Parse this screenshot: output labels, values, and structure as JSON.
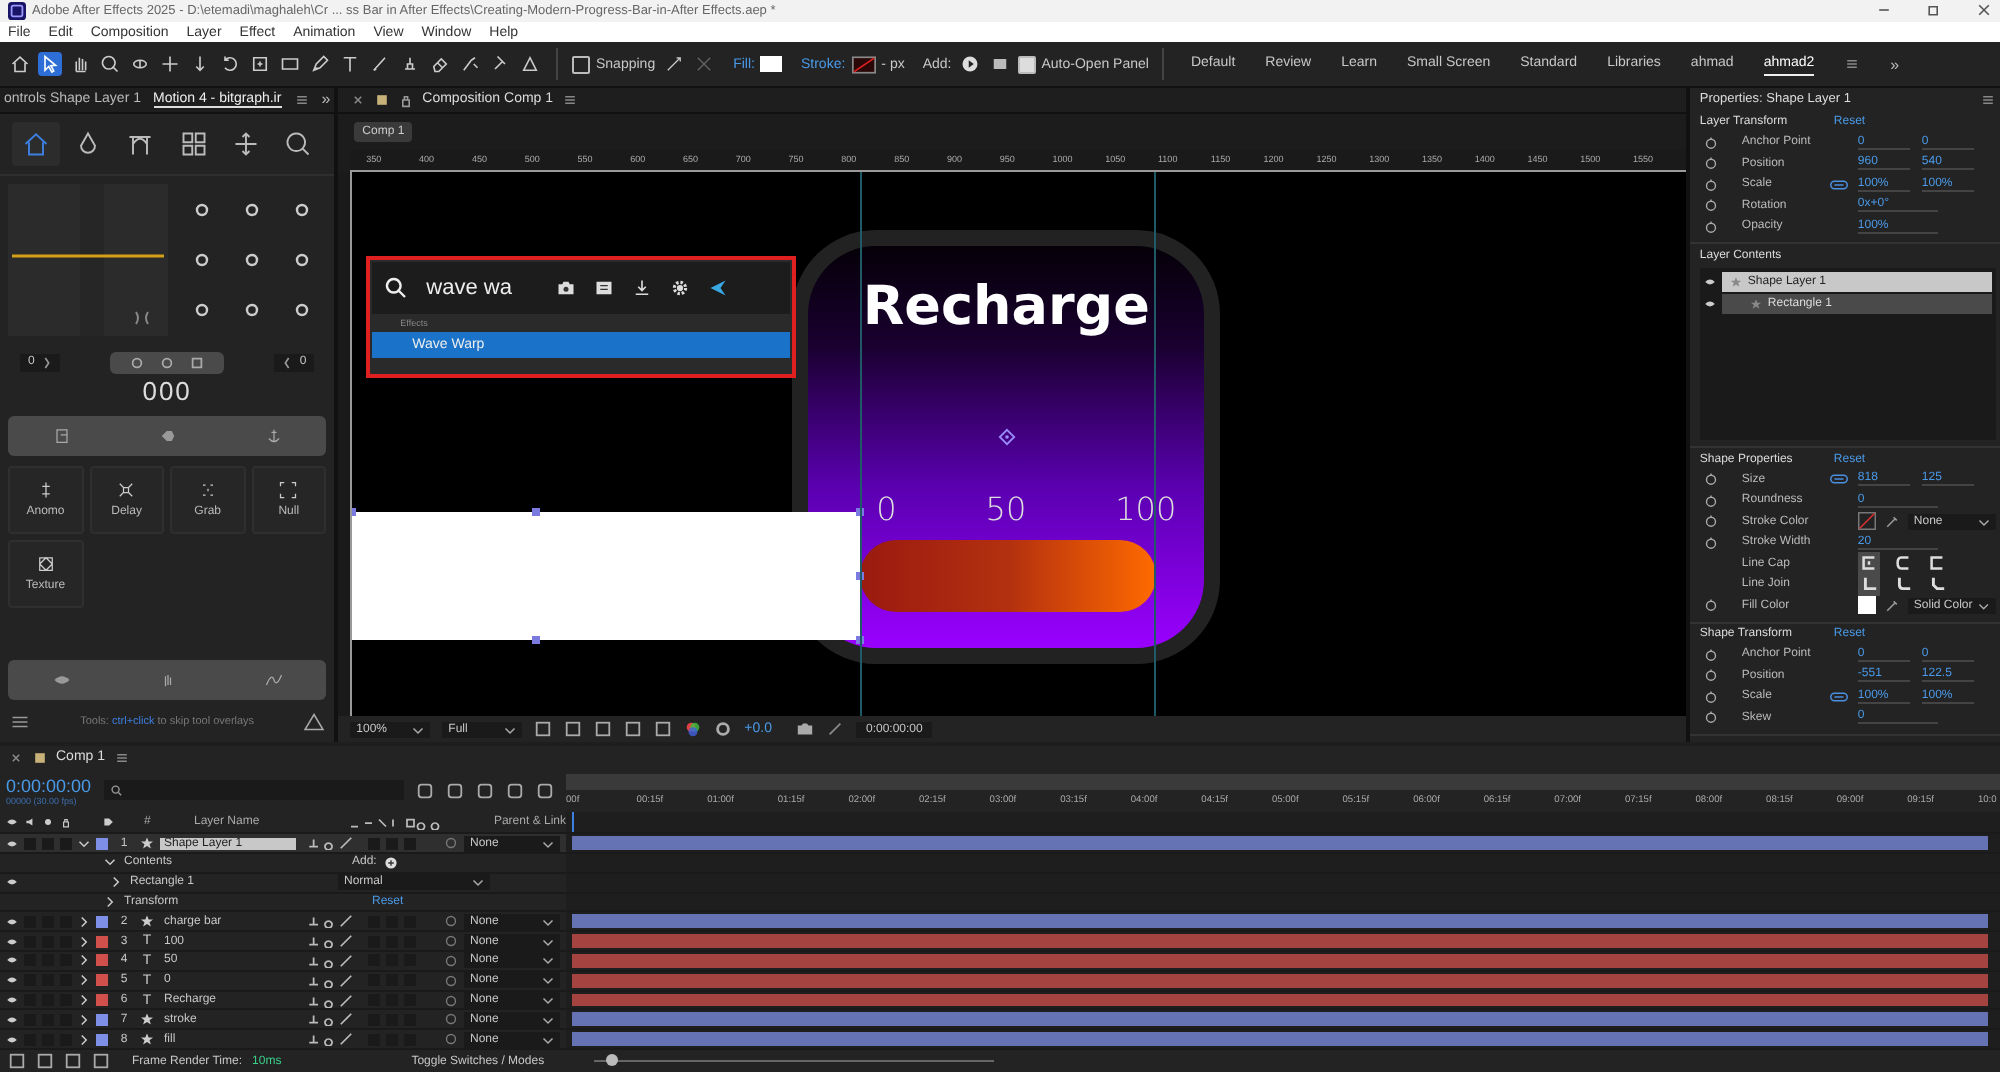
{
  "window": {
    "title": "Adobe After Effects 2025 - D:\\etemadi\\maghaleh\\Cr ... ss Bar in After Effects\\Creating-Modern-Progress-Bar-in-After Effects.aep *"
  },
  "menu": [
    "File",
    "Edit",
    "Composition",
    "Layer",
    "Effect",
    "Animation",
    "View",
    "Window",
    "Help"
  ],
  "toolbar": {
    "tools": [
      {
        "selected": false
      },
      {
        "selected": true
      },
      {
        "selected": false
      },
      {
        "selected": false
      },
      {
        "selected": false
      },
      {
        "selected": false
      },
      {
        "selected": false
      },
      {
        "selected": false
      },
      {
        "selected": false
      },
      {
        "selected": false
      },
      {
        "selected": false
      },
      {
        "selected": false
      },
      {
        "selected": false
      },
      {
        "selected": false
      },
      {
        "selected": false
      },
      {
        "selected": false
      },
      {
        "selected": false
      },
      {
        "selected": false
      }
    ],
    "snapping": {
      "label": "Snapping",
      "checked": false
    },
    "fill_label": "Fill:",
    "stroke_label": "Stroke:",
    "stroke_unit": "- px",
    "add_label": "Add:",
    "auto_open": {
      "label": "Auto-Open Panel",
      "checked": true
    }
  },
  "workspaces": [
    {
      "label": "Default",
      "selected": false
    },
    {
      "label": "Review",
      "selected": false
    },
    {
      "label": "Learn",
      "selected": false
    },
    {
      "label": "Small Screen",
      "selected": false
    },
    {
      "label": "Standard",
      "selected": false
    },
    {
      "label": "Libraries",
      "selected": false
    },
    {
      "label": "ahmad",
      "selected": false
    },
    {
      "label": "ahmad2",
      "selected": true
    }
  ],
  "workspace_more": "»",
  "left_panel": {
    "tabs": [
      {
        "label": "ontrols Shape Layer 1",
        "selected": false
      },
      {
        "label": "Motion 4 - bitgraph.ir",
        "selected": true
      }
    ],
    "more": "»",
    "nav": [
      {
        "selected": true
      },
      {
        "selected": false
      },
      {
        "selected": false
      },
      {
        "selected": false
      },
      {
        "selected": false
      },
      {
        "selected": false
      }
    ],
    "left_value": "0",
    "right_value": "0",
    "counter": "000",
    "tools": [
      "Anomo",
      "Delay",
      "Grab",
      "Null",
      "Texture"
    ],
    "tip": {
      "prefix": "Tools:",
      "keys": "ctrl+click",
      "suffix": "to skip tool overlays"
    }
  },
  "comp_panel": {
    "tab": "Composition Comp 1",
    "subtab": "Comp 1",
    "ruler": [
      "350",
      "400",
      "450",
      "500",
      "550",
      "600",
      "650",
      "700",
      "750",
      "800",
      "850",
      "900",
      "950",
      "1000",
      "1050",
      "1100",
      "1150",
      "1200",
      "1250",
      "1300",
      "1350",
      "1400",
      "1450",
      "1500",
      "1550"
    ],
    "popup": {
      "query": "wave wa",
      "group": "Effects",
      "results": [
        {
          "label": "Wave Warp",
          "selected": true
        }
      ]
    },
    "artwork": {
      "title": "Recharge",
      "scale": [
        "0",
        "50",
        "100"
      ]
    },
    "viewer_bar": {
      "zoom": "100%",
      "resolution": "Full",
      "exposure": "+0.0",
      "timecode": "0:00:00:00"
    }
  },
  "properties": {
    "title": "Properties: Shape Layer 1",
    "transform": {
      "title": "Layer Transform",
      "reset": "Reset",
      "rows": [
        {
          "kind": "pair",
          "label": "Anchor Point",
          "values": [
            "0",
            "0"
          ]
        },
        {
          "kind": "pair",
          "label": "Position",
          "values": [
            "960",
            "540"
          ]
        },
        {
          "kind": "pair",
          "label": "Scale",
          "values": [
            "100%",
            "100%"
          ],
          "linked": true
        },
        {
          "kind": "single",
          "label": "Rotation",
          "values": [
            "0x+0°"
          ]
        },
        {
          "kind": "single",
          "label": "Opacity",
          "values": [
            "100%"
          ]
        }
      ]
    },
    "contents": {
      "title": "Layer Contents",
      "items": [
        {
          "label": "Shape Layer 1",
          "selected": true,
          "children": [
            {
              "label": "Rectangle 1",
              "selected": false
            }
          ]
        }
      ]
    },
    "shape": {
      "title": "Shape Properties",
      "reset": "Reset",
      "rows": [
        {
          "kind": "pair",
          "label": "Size",
          "values": [
            "818",
            "125"
          ],
          "linked": true
        },
        {
          "kind": "single",
          "label": "Roundness",
          "values": [
            "0"
          ]
        },
        {
          "kind": "no_color",
          "label": "Stroke Color",
          "option": "None"
        },
        {
          "kind": "single",
          "label": "Stroke Width",
          "values": [
            "20"
          ]
        },
        {
          "kind": "caps",
          "label": "Line Cap"
        },
        {
          "kind": "joins",
          "label": "Line Join"
        },
        {
          "kind": "solid_color",
          "label": "Fill Color",
          "option": "Solid Color"
        }
      ]
    },
    "shape_transform": {
      "title": "Shape Transform",
      "reset": "Reset",
      "rows": [
        {
          "kind": "pair",
          "label": "Anchor Point",
          "values": [
            "0",
            "0"
          ]
        },
        {
          "kind": "pair",
          "label": "Position",
          "values": [
            "-551",
            "122.5"
          ]
        },
        {
          "kind": "pair",
          "label": "Scale",
          "values": [
            "100%",
            "100%"
          ],
          "linked": true
        },
        {
          "kind": "single",
          "label": "Skew",
          "values": [
            "0"
          ]
        }
      ]
    }
  },
  "timeline": {
    "tab": "Comp 1",
    "timecode": "0:00:00:00",
    "frame_info": "00000 (30.00 fps)",
    "columns": {
      "number": "#",
      "name": "Layer Name",
      "parent": "Parent & Link"
    },
    "ruler": [
      "00f",
      "00:15f",
      "01:00f",
      "01:15f",
      "02:00f",
      "02:15f",
      "03:00f",
      "03:15f",
      "04:00f",
      "04:15f",
      "05:00f",
      "05:15f",
      "06:00f",
      "06:15f",
      "07:00f",
      "07:15f",
      "08:00f",
      "08:15f",
      "09:00f",
      "09:15f",
      "10:0"
    ],
    "layers": [
      {
        "number": "1",
        "name": "Shape Layer 1",
        "kind": "shape",
        "color": "#7d8fe6",
        "expanded": true,
        "selected": true,
        "parent": "None",
        "children": [
          {
            "kind": "group",
            "label": "Contents",
            "extra": "Add:"
          },
          {
            "kind": "item",
            "label": "Rectangle 1",
            "extra": "Normal"
          },
          {
            "kind": "transform",
            "label": "Transform",
            "extra": "Reset"
          }
        ]
      },
      {
        "number": "2",
        "name": "charge bar",
        "kind": "shape",
        "color": "#7d8fe6",
        "expanded": false,
        "selected": false,
        "parent": "None"
      },
      {
        "number": "3",
        "name": "100",
        "kind": "text",
        "glyph": "T",
        "color": "#d2504b",
        "expanded": false,
        "selected": false,
        "parent": "None"
      },
      {
        "number": "4",
        "name": "50",
        "kind": "text",
        "glyph": "T",
        "color": "#d2504b",
        "expanded": false,
        "selected": false,
        "parent": "None"
      },
      {
        "number": "5",
        "name": "0",
        "kind": "text",
        "glyph": "T",
        "color": "#d2504b",
        "expanded": false,
        "selected": false,
        "parent": "None"
      },
      {
        "number": "6",
        "name": "Recharge",
        "kind": "text",
        "glyph": "T",
        "color": "#d2504b",
        "expanded": false,
        "selected": false,
        "parent": "None"
      },
      {
        "number": "7",
        "name": "stroke",
        "kind": "shape",
        "color": "#7d8fe6",
        "expanded": false,
        "selected": false,
        "parent": "None"
      },
      {
        "number": "8",
        "name": "fill",
        "kind": "shape",
        "color": "#7d8fe6",
        "expanded": false,
        "selected": false,
        "parent": "None"
      }
    ],
    "zoom": {
      "level": 0.03
    },
    "render_label": "Frame Render Time:",
    "render_value": "10ms",
    "toggle": "Toggle Switches / Modes"
  }
}
